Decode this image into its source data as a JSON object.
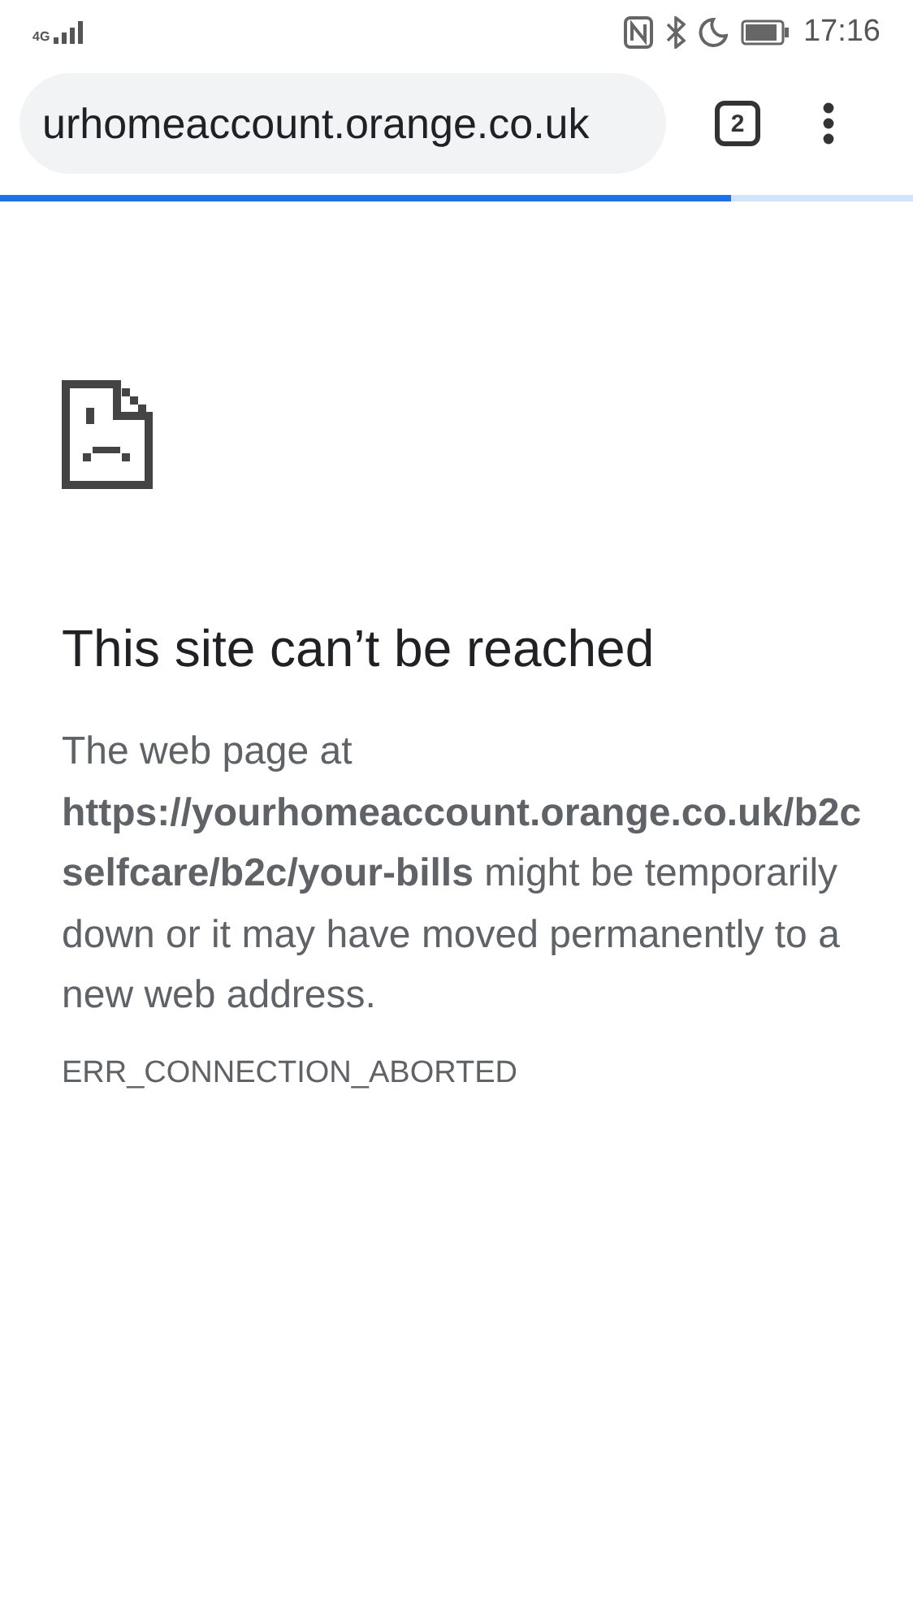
{
  "status_bar": {
    "network": "4G",
    "time": "17:16"
  },
  "browser": {
    "url": "urhomeaccount.orange.co.uk",
    "tab_count": "2",
    "progress": {
      "level": 0.8
    }
  },
  "error": {
    "title": "This site can’t be reached",
    "message": "The web page at **https://yourhomeaccount.orange.co.uk/b2cselfcare/b2c/your-bills** might be temporarily down or it may have moved permanently to a new web address.",
    "code": "ERR_CONNECTION_ABORTED"
  }
}
